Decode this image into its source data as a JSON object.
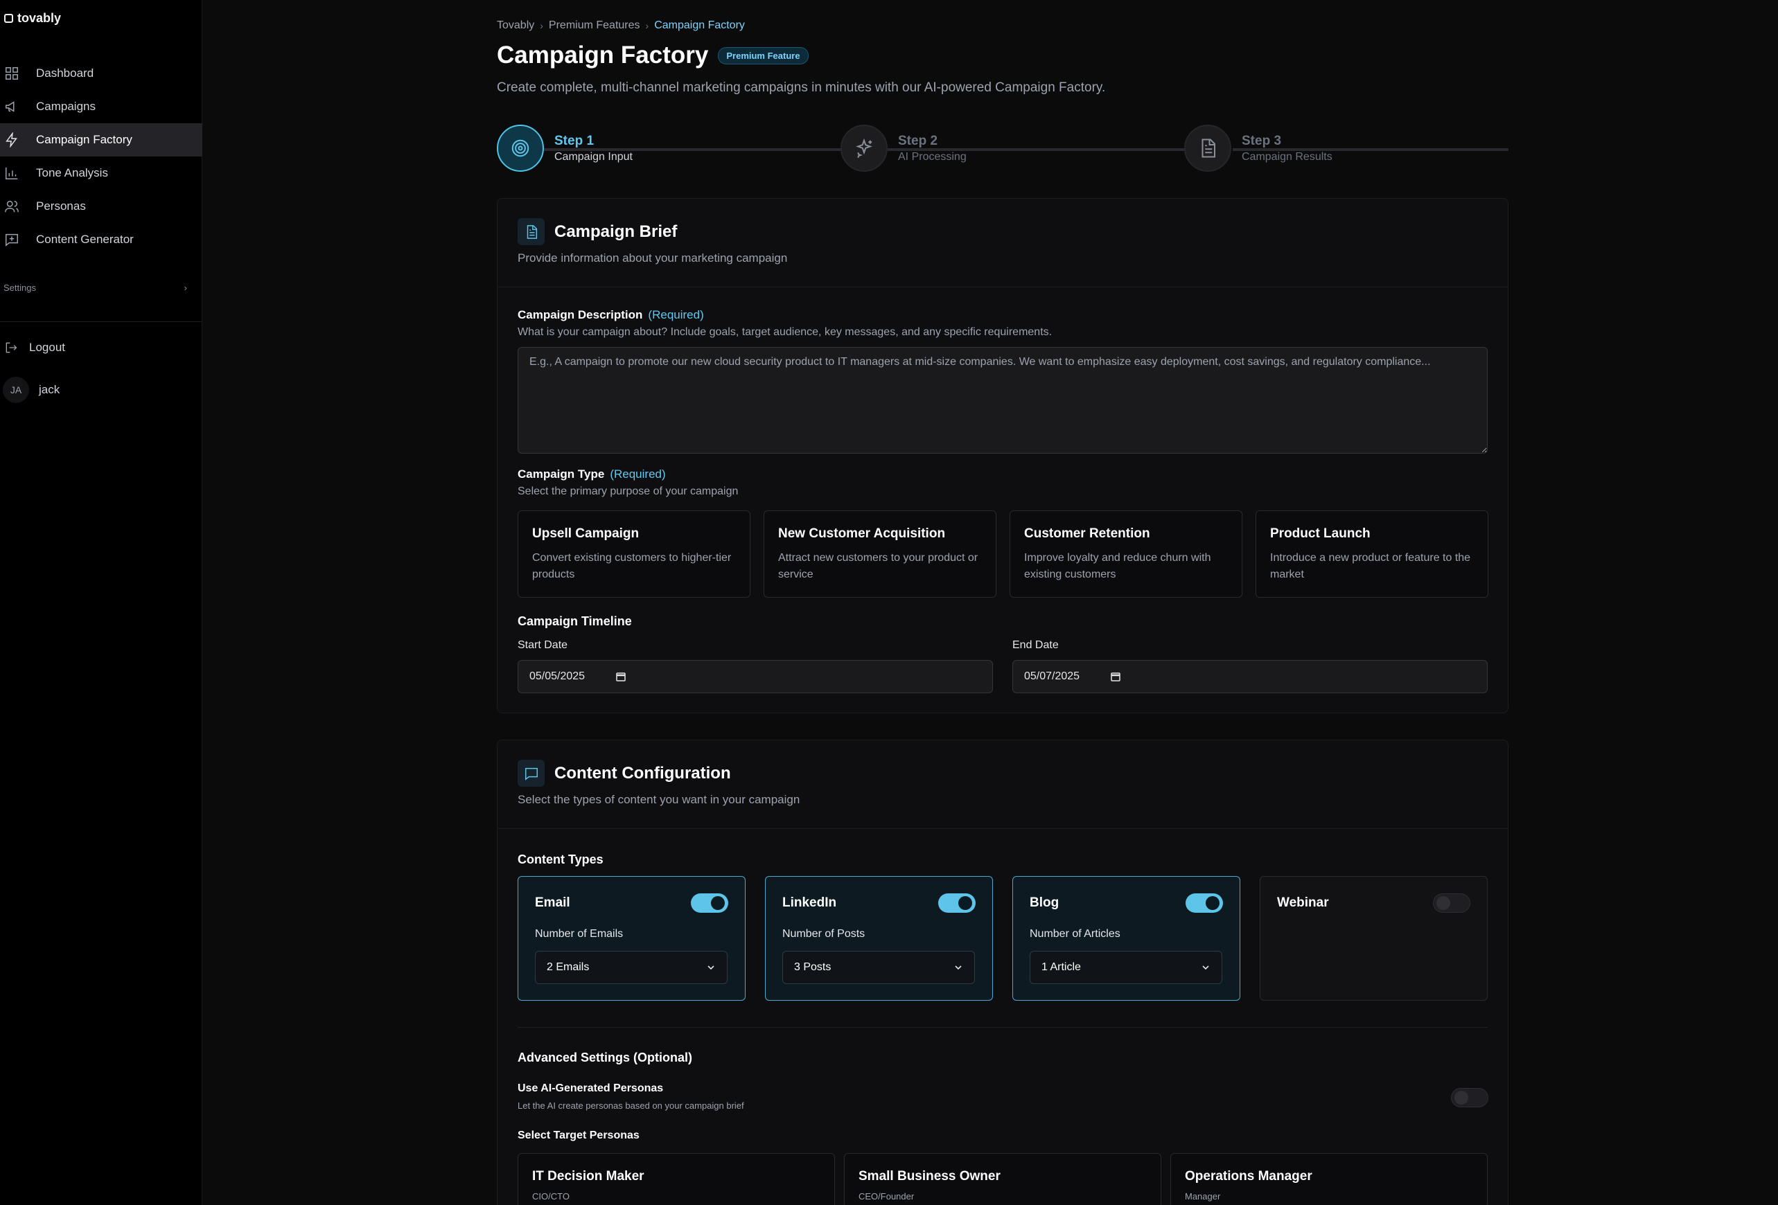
{
  "app": {
    "name": "tovably"
  },
  "sidebar": {
    "items": [
      {
        "label": "Dashboard",
        "icon": "dashboard-icon"
      },
      {
        "label": "Campaigns",
        "icon": "megaphone-icon"
      },
      {
        "label": "Campaign Factory",
        "icon": "lightning-icon",
        "active": true
      },
      {
        "label": "Tone Analysis",
        "icon": "bar-chart-icon"
      },
      {
        "label": "Personas",
        "icon": "users-icon"
      },
      {
        "label": "Content Generator",
        "icon": "message-plus-icon"
      }
    ],
    "settings_label": "Settings",
    "logout_label": "Logout",
    "user": {
      "initials": "JA",
      "name": "jack"
    }
  },
  "breadcrumb": {
    "items": [
      "Tovably",
      "Premium Features"
    ],
    "current": "Campaign Factory"
  },
  "header": {
    "title": "Campaign Factory",
    "badge": "Premium Feature",
    "subtitle": "Create complete, multi-channel marketing campaigns in minutes with our AI-powered Campaign Factory."
  },
  "stepper": {
    "steps": [
      {
        "title": "Step 1",
        "subtitle": "Campaign Input",
        "active": true
      },
      {
        "title": "Step 2",
        "subtitle": "AI Processing",
        "active": false
      },
      {
        "title": "Step 3",
        "subtitle": "Campaign Results",
        "active": false
      }
    ]
  },
  "brief": {
    "title": "Campaign Brief",
    "subtitle": "Provide information about your marketing campaign",
    "description_label": "Campaign Description",
    "required": "(Required)",
    "description_help": "What is your campaign about? Include goals, target audience, key messages, and any specific requirements.",
    "description_placeholder": "E.g., A campaign to promote our new cloud security product to IT managers at mid-size companies. We want to emphasize easy deployment, cost savings, and regulatory compliance...",
    "description_value": "",
    "type_label": "Campaign Type",
    "type_help": "Select the primary purpose of your campaign",
    "types": [
      {
        "title": "Upsell Campaign",
        "desc": "Convert existing customers to higher-tier products"
      },
      {
        "title": "New Customer Acquisition",
        "desc": "Attract new customers to your product or service"
      },
      {
        "title": "Customer Retention",
        "desc": "Improve loyalty and reduce churn with existing customers"
      },
      {
        "title": "Product Launch",
        "desc": "Introduce a new product or feature to the market"
      }
    ],
    "timeline_label": "Campaign Timeline",
    "start_label": "Start Date",
    "start_value": "05/05/2025",
    "end_label": "End Date",
    "end_value": "05/07/2025"
  },
  "content": {
    "title": "Content Configuration",
    "subtitle": "Select the types of content you want in your campaign",
    "types_label": "Content Types",
    "types": [
      {
        "name": "Email",
        "enabled": true,
        "count_label": "Number of Emails",
        "count_value": "2 Emails"
      },
      {
        "name": "LinkedIn",
        "enabled": true,
        "count_label": "Number of Posts",
        "count_value": "3 Posts"
      },
      {
        "name": "Blog",
        "enabled": true,
        "count_label": "Number of Articles",
        "count_value": "1 Article"
      },
      {
        "name": "Webinar",
        "enabled": false
      }
    ],
    "advanced_label": "Advanced Settings (Optional)",
    "ai_personas_label": "Use AI-Generated Personas",
    "ai_personas_help": "Let the AI create personas based on your campaign brief",
    "ai_personas_enabled": false,
    "personas_label": "Select Target Personas",
    "personas": [
      {
        "title": "IT Decision Maker",
        "sub": "CIO/CTO"
      },
      {
        "title": "Small Business Owner",
        "sub": "CEO/Founder"
      },
      {
        "title": "Operations Manager",
        "sub": "Manager"
      }
    ]
  },
  "colors": {
    "accent": "#5fc4ea",
    "background": "#0b0b0c",
    "sidebar": "#000000"
  }
}
